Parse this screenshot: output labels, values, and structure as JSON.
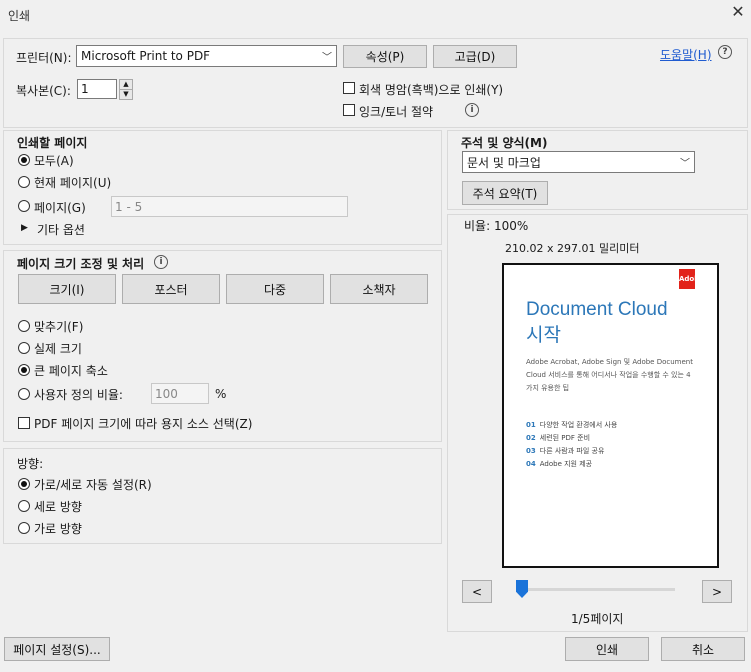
{
  "window": {
    "title": "인쇄"
  },
  "printer": {
    "label": "프린터(N):",
    "selected": "Microsoft Print to PDF",
    "properties_btn": "속성(P)",
    "advanced_btn": "고급(D)",
    "help_link": "도움말(H)"
  },
  "copies": {
    "label": "복사본(C):",
    "value": "1"
  },
  "options": {
    "grayscale": "회색 명암(흑백)으로 인쇄(Y)",
    "save_ink": "잉크/토너 절약"
  },
  "pages": {
    "heading": "인쇄할 페이지",
    "all": "모두(A)",
    "current": "현재 페이지(U)",
    "range": "페이지(G)",
    "range_value": "1 - 5",
    "more": "기타 옵션"
  },
  "sizing": {
    "heading": "페이지 크기 조정 및 처리",
    "btn_size": "크기(I)",
    "btn_poster": "포스터",
    "btn_multiple": "다중",
    "btn_booklet": "소책자",
    "fit": "맞추기(F)",
    "actual": "실제 크기",
    "shrink": "큰 페이지 축소",
    "custom": "사용자 정의 비율:",
    "custom_value": "100",
    "percent": "%",
    "paper_source": "PDF 페이지 크기에 따라 용지 소스 선택(Z)"
  },
  "orientation": {
    "heading": "방향:",
    "auto": "가로/세로 자동 설정(R)",
    "portrait": "세로 방향",
    "landscape": "가로 방향"
  },
  "comments": {
    "heading": "주석 및 양식(M)",
    "selected": "문서 및 마크업",
    "summarize_btn": "주석 요약(T)"
  },
  "preview": {
    "scale": "비율: 100%",
    "dimensions": "210.02 x 297.01 밀리미터",
    "doc_title_1": "Document Cloud",
    "doc_title_2": "시작",
    "doc_desc": "Adobe Acrobat, Adobe Sign 및 Adobe Document Cloud 서비스를 통해 어디서나 작업을 수행할 수 있는 4가지 유용한 팁",
    "list": [
      {
        "num": "01",
        "text": "다양한 작업 환경에서 사용"
      },
      {
        "num": "02",
        "text": "세련된 PDF 준비"
      },
      {
        "num": "03",
        "text": "다른 사람과 파일 공유"
      },
      {
        "num": "04",
        "text": "Adobe 지원 제공"
      }
    ],
    "logo_text": "Adobe",
    "prev_btn": "<",
    "next_btn": ">",
    "page_indicator": "1/5페이지",
    "slider_position": 0
  },
  "footer": {
    "page_setup": "페이지 설정(S)...",
    "print": "인쇄",
    "cancel": "취소"
  }
}
